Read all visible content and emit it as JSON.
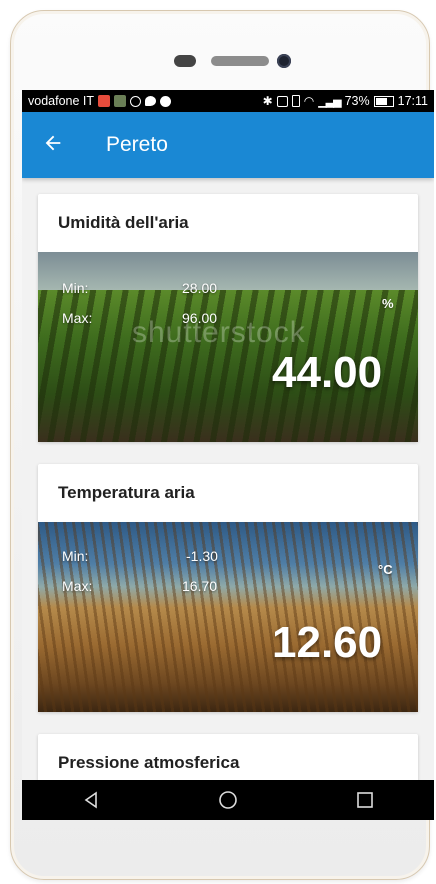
{
  "status_bar": {
    "carrier": "vodafone IT",
    "battery": "73%",
    "time": "17:11"
  },
  "app_bar": {
    "title": "Pereto",
    "back_icon": "arrow-left-icon"
  },
  "cards": [
    {
      "title": "Umidità dell'aria",
      "min_label": "Min:",
      "min_value": "28.00",
      "max_label": "Max:",
      "max_value": "96.00",
      "unit": "%",
      "current": "44.00",
      "watermark": "shutterstock"
    },
    {
      "title": "Temperatura aria",
      "min_label": "Min:",
      "min_value": "-1.30",
      "max_label": "Max:",
      "max_value": "16.70",
      "unit": "°C",
      "current": "12.60"
    },
    {
      "title": "Pressione atmosferica"
    }
  ],
  "nav_bar": {
    "back_icon": "triangle-back-icon",
    "home_icon": "circle-home-icon",
    "recents_icon": "square-recents-icon"
  },
  "colors": {
    "accent": "#1a88d4",
    "status_bar": "#000000"
  }
}
